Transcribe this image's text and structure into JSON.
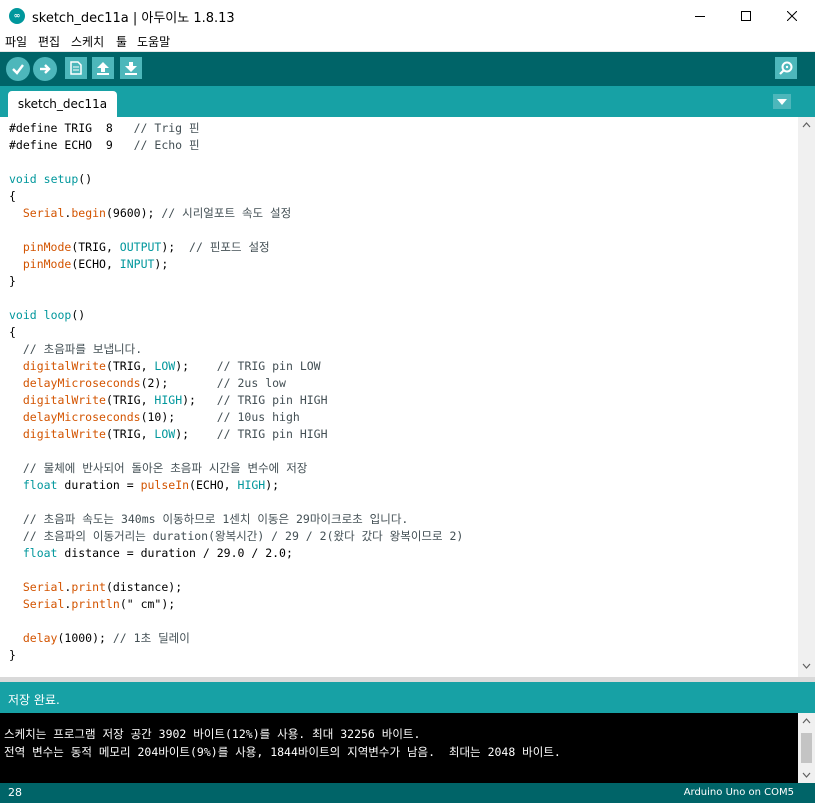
{
  "window": {
    "title": "sketch_dec11a | 아두이노 1.8.13",
    "app_icon_text": "∞"
  },
  "menu": [
    {
      "label": "파일"
    },
    {
      "label": "편집"
    },
    {
      "label": "스케치"
    },
    {
      "label": "툴"
    },
    {
      "label": "도움말"
    }
  ],
  "toolbar": {
    "buttons": [
      {
        "name": "verify-button",
        "icon": "check-icon"
      },
      {
        "name": "upload-button",
        "icon": "arrow-right-icon"
      },
      {
        "name": "new-button",
        "icon": "new-file-icon"
      },
      {
        "name": "open-button",
        "icon": "arrow-up-icon"
      },
      {
        "name": "save-button",
        "icon": "arrow-down-icon"
      },
      {
        "name": "serial-monitor-button",
        "icon": "magnifier-icon"
      }
    ]
  },
  "tabs": [
    {
      "label": "sketch_dec11a",
      "active": true
    }
  ],
  "code_lines": [
    [
      {
        "t": "#define TRIG  8   "
      },
      {
        "t": "// Trig 핀",
        "c": "cm"
      }
    ],
    [
      {
        "t": "#define ECHO  9   "
      },
      {
        "t": "// Echo 핀",
        "c": "cm"
      }
    ],
    [],
    [
      {
        "t": "void",
        "c": "kw"
      },
      {
        "t": " "
      },
      {
        "t": "setup",
        "c": "kw"
      },
      {
        "t": "()"
      }
    ],
    [
      {
        "t": "{"
      }
    ],
    [
      {
        "t": "  "
      },
      {
        "t": "Serial",
        "c": "fn"
      },
      {
        "t": "."
      },
      {
        "t": "begin",
        "c": "fn"
      },
      {
        "t": "(9600); "
      },
      {
        "t": "// 시리얼포트 속도 설정",
        "c": "cm"
      }
    ],
    [],
    [
      {
        "t": "  "
      },
      {
        "t": "pinMode",
        "c": "fn"
      },
      {
        "t": "(TRIG, "
      },
      {
        "t": "OUTPUT",
        "c": "cons"
      },
      {
        "t": ");  "
      },
      {
        "t": "// 핀포드 설정",
        "c": "cm"
      }
    ],
    [
      {
        "t": "  "
      },
      {
        "t": "pinMode",
        "c": "fn"
      },
      {
        "t": "(ECHO, "
      },
      {
        "t": "INPUT",
        "c": "cons"
      },
      {
        "t": ");"
      }
    ],
    [
      {
        "t": "}"
      }
    ],
    [],
    [
      {
        "t": "void",
        "c": "kw"
      },
      {
        "t": " "
      },
      {
        "t": "loop",
        "c": "kw"
      },
      {
        "t": "()"
      }
    ],
    [
      {
        "t": "{"
      }
    ],
    [
      {
        "t": "  "
      },
      {
        "t": "// 초음파를 보냅니다.",
        "c": "cm"
      }
    ],
    [
      {
        "t": "  "
      },
      {
        "t": "digitalWrite",
        "c": "fn"
      },
      {
        "t": "(TRIG, "
      },
      {
        "t": "LOW",
        "c": "cons"
      },
      {
        "t": ");    "
      },
      {
        "t": "// TRIG pin LOW",
        "c": "cm"
      }
    ],
    [
      {
        "t": "  "
      },
      {
        "t": "delayMicroseconds",
        "c": "fn"
      },
      {
        "t": "(2);       "
      },
      {
        "t": "// 2us low",
        "c": "cm"
      }
    ],
    [
      {
        "t": "  "
      },
      {
        "t": "digitalWrite",
        "c": "fn"
      },
      {
        "t": "(TRIG, "
      },
      {
        "t": "HIGH",
        "c": "cons"
      },
      {
        "t": ");   "
      },
      {
        "t": "// TRIG pin HIGH",
        "c": "cm"
      }
    ],
    [
      {
        "t": "  "
      },
      {
        "t": "delayMicroseconds",
        "c": "fn"
      },
      {
        "t": "(10);      "
      },
      {
        "t": "// 10us high",
        "c": "cm"
      }
    ],
    [
      {
        "t": "  "
      },
      {
        "t": "digitalWrite",
        "c": "fn"
      },
      {
        "t": "(TRIG, "
      },
      {
        "t": "LOW",
        "c": "cons"
      },
      {
        "t": ");    "
      },
      {
        "t": "// TRIG pin HIGH",
        "c": "cm"
      }
    ],
    [],
    [
      {
        "t": "  "
      },
      {
        "t": "// 물체에 반사되어 돌아온 초음파 시간을 변수에 저장",
        "c": "cm"
      }
    ],
    [
      {
        "t": "  "
      },
      {
        "t": "float",
        "c": "kw"
      },
      {
        "t": " duration = "
      },
      {
        "t": "pulseIn",
        "c": "fn"
      },
      {
        "t": "(ECHO, "
      },
      {
        "t": "HIGH",
        "c": "cons"
      },
      {
        "t": ");"
      }
    ],
    [],
    [
      {
        "t": "  "
      },
      {
        "t": "// 초음파 속도는 340ms 이동하므로 1센치 이동은 29마이크로초 입니다.",
        "c": "cm"
      }
    ],
    [
      {
        "t": "  "
      },
      {
        "t": "// 초음파의 이동거리는 duration(왕복시간) / 29 / 2(왔다 갔다 왕복이므로 2)",
        "c": "cm"
      }
    ],
    [
      {
        "t": "  "
      },
      {
        "t": "float",
        "c": "kw"
      },
      {
        "t": " distance = duration / 29.0 / 2.0;"
      }
    ],
    [],
    [
      {
        "t": "  "
      },
      {
        "t": "Serial",
        "c": "fn"
      },
      {
        "t": "."
      },
      {
        "t": "print",
        "c": "fn"
      },
      {
        "t": "(distance);"
      }
    ],
    [
      {
        "t": "  "
      },
      {
        "t": "Serial",
        "c": "fn"
      },
      {
        "t": "."
      },
      {
        "t": "println",
        "c": "fn"
      },
      {
        "t": "(\" cm\");"
      }
    ],
    [],
    [
      {
        "t": "  "
      },
      {
        "t": "delay",
        "c": "fn"
      },
      {
        "t": "(1000); "
      },
      {
        "t": "// 1초 딜레이",
        "c": "cm"
      }
    ],
    [
      {
        "t": "}"
      }
    ]
  ],
  "status": {
    "message": "저장 완료."
  },
  "console": {
    "lines": [
      "스케치는 프로그램 저장 공간 3902 바이트(12%)를 사용. 최대 32256 바이트.",
      "전역 변수는 동적 메모리 204바이트(9%)를 사용, 1844바이트의 지역변수가 남음.  최대는 2048 바이트."
    ]
  },
  "footer": {
    "line_number": "28",
    "board": "Arduino Uno on COM5"
  },
  "colors": {
    "toolbar": "#006468",
    "tabbar": "#17a1a5",
    "button": "#4db7bb",
    "keyword": "#00979c",
    "function": "#d35400",
    "comment": "#434f54"
  }
}
